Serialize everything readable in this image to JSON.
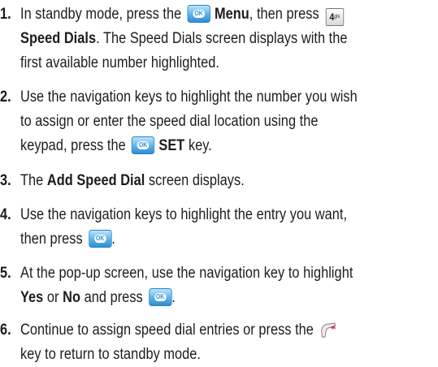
{
  "steps": [
    {
      "number": "1.",
      "l1_a": "In standby mode, press the",
      "l1_b": "Menu",
      "l1_c": ", then press",
      "l2_a": "Speed Dials",
      "l2_b": ". The Speed Dials screen displays with the",
      "l3": "first available number highlighted."
    },
    {
      "number": "2.",
      "l1": "Use the navigation keys to highlight the number you wish",
      "l2": "to assign or enter the speed dial location using the",
      "l3_a": "keypad, press the",
      "l3_b": "SET",
      "l3_c": "key."
    },
    {
      "number": "3.",
      "a": "The",
      "b": "Add Speed Dial",
      "c": "screen displays."
    },
    {
      "number": "4.",
      "l1": "Use the navigation keys to highlight the entry you want,",
      "l2_a": "then press",
      "l2_b": "."
    },
    {
      "number": "5.",
      "l1": "At the pop-up screen, use the navigation key to highlight",
      "l2_a": "Yes",
      "l2_b": "or",
      "l2_c": "No",
      "l2_d": "and press",
      "l2_e": "."
    },
    {
      "number": "6.",
      "l1": "Continue to assign speed dial entries or press the",
      "l2": "key to return to standby mode."
    }
  ],
  "icons": {
    "ok_key_text": "OK",
    "four_key_text": "4",
    "four_key_sub": "ghi",
    "ok_key_color": "#3a9be0",
    "end_key_color": "#d93a7a"
  }
}
